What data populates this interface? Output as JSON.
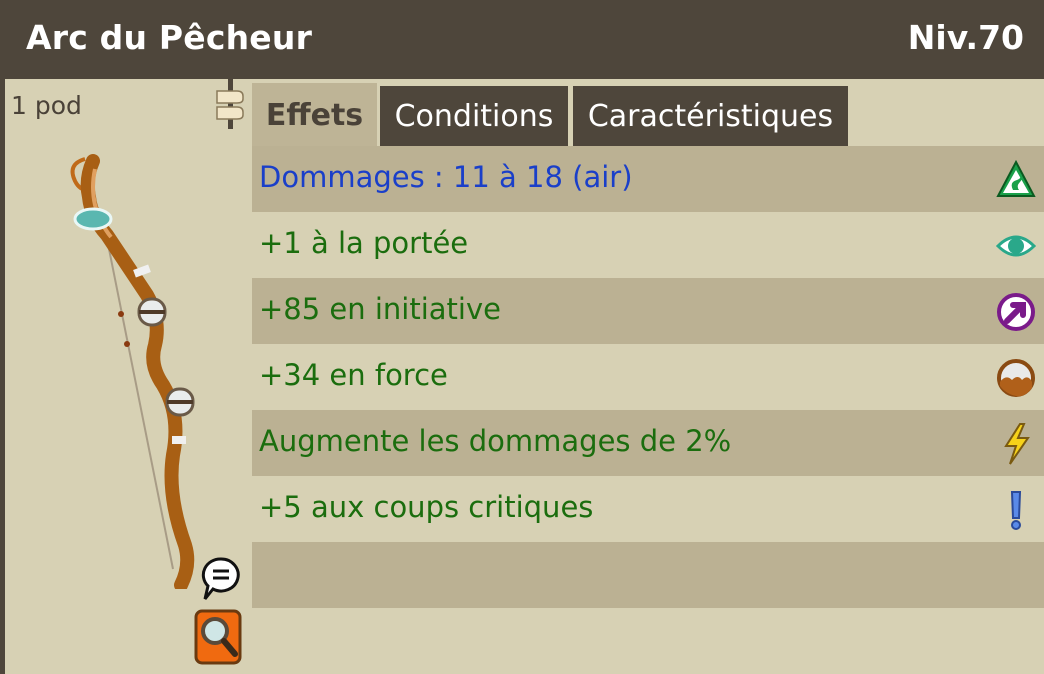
{
  "item": {
    "name": "Arc du Pêcheur",
    "level": "Niv.70",
    "pods": "1 pod"
  },
  "tabs": [
    {
      "label": "Effets",
      "active": true
    },
    {
      "label": "Conditions",
      "active": false
    },
    {
      "label": "Caractéristiques",
      "active": false
    }
  ],
  "effects": [
    {
      "text": "Dommages : 11 à 18 (air)",
      "color": "#1a3fc9",
      "icon": "air-element-icon"
    },
    {
      "text": "+1 à la portée",
      "color": "#1b6d0e",
      "icon": "range-eye-icon"
    },
    {
      "text": "+85 en initiative",
      "color": "#1b6d0e",
      "icon": "initiative-icon"
    },
    {
      "text": "+34 en force",
      "color": "#1b6d0e",
      "icon": "strength-icon"
    },
    {
      "text": "Augmente les dommages de 2%",
      "color": "#1b6d0e",
      "icon": "damage-lightning-icon"
    },
    {
      "text": "+5 aux coups critiques",
      "color": "#1b6d0e",
      "icon": "critical-exclamation-icon"
    }
  ],
  "colors": {
    "header_bg": "#4e463b",
    "panel_bg": "#d7d1b4",
    "row_dark": "#bbb193",
    "effect_green": "#1b6d0e",
    "effect_blue": "#1a3fc9"
  }
}
